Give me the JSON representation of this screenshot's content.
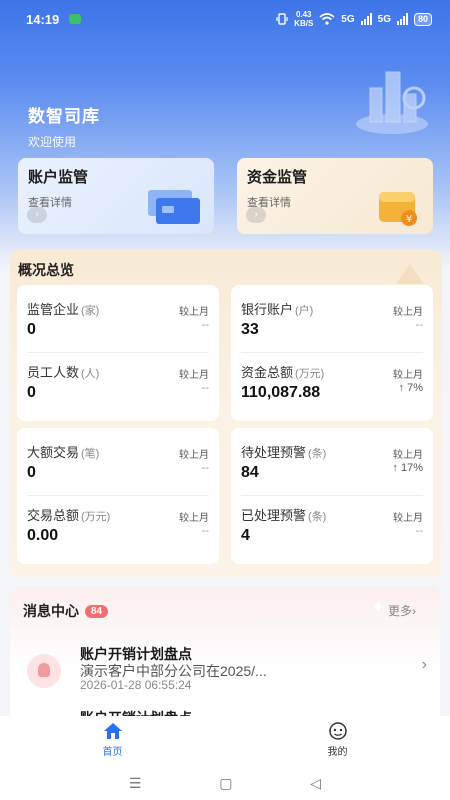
{
  "status_bar": {
    "time": "14:19",
    "net_speed_value": "0.43",
    "net_speed_unit": "KB/S",
    "signal_1": "5G",
    "signal_2": "5G",
    "battery": "80"
  },
  "brand": {
    "title": "数智司库",
    "subtitle": "欢迎使用"
  },
  "entries": [
    {
      "title": "账户监管",
      "subtitle": "查看详情"
    },
    {
      "title": "资金监管",
      "subtitle": "查看详情"
    }
  ],
  "overview": {
    "title": "概况总览",
    "compare_label": "较上月",
    "cards": [
      {
        "rows": [
          {
            "label": "监管企业",
            "unit": "(家)",
            "value": "0",
            "delta": "--",
            "direction": "none"
          },
          {
            "label": "员工人数",
            "unit": "(人)",
            "value": "0",
            "delta": "--",
            "direction": "none"
          }
        ]
      },
      {
        "rows": [
          {
            "label": "银行账户",
            "unit": "(户)",
            "value": "33",
            "delta": "--",
            "direction": "none"
          },
          {
            "label": "资金总额",
            "unit": "(万元)",
            "value": "110,087.88",
            "delta": "7%",
            "direction": "up"
          }
        ]
      },
      {
        "rows": [
          {
            "label": "大额交易",
            "unit": "(笔)",
            "value": "0",
            "delta": "--",
            "direction": "none"
          },
          {
            "label": "交易总额",
            "unit": "(万元)",
            "value": "0.00",
            "delta": "--",
            "direction": "none"
          }
        ]
      },
      {
        "rows": [
          {
            "label": "待处理预警",
            "unit": "(条)",
            "value": "84",
            "delta": "17%",
            "direction": "up"
          },
          {
            "label": "已处理预警",
            "unit": "(条)",
            "value": "4",
            "delta": "--",
            "direction": "none"
          }
        ]
      }
    ]
  },
  "messages": {
    "title": "消息中心",
    "badge": "84",
    "more_label": "更多",
    "items": [
      {
        "title": "账户开销计划盘点",
        "desc": "演示客户中部分公司在2025/...",
        "time": "2026-01-28 06:55:24"
      },
      {
        "title": "账户开销计划盘点",
        "desc": "",
        "time": ""
      }
    ]
  },
  "tabbar": {
    "tabs": [
      {
        "label": "首页",
        "icon": "home-icon",
        "active": true
      },
      {
        "label": "我的",
        "icon": "profile-icon",
        "active": false
      }
    ]
  },
  "colors": {
    "primary": "#2e6ff2",
    "hero_blue": "#3f74e8",
    "badge_red": "#f07070",
    "overview_bg": "#f8ead4"
  }
}
